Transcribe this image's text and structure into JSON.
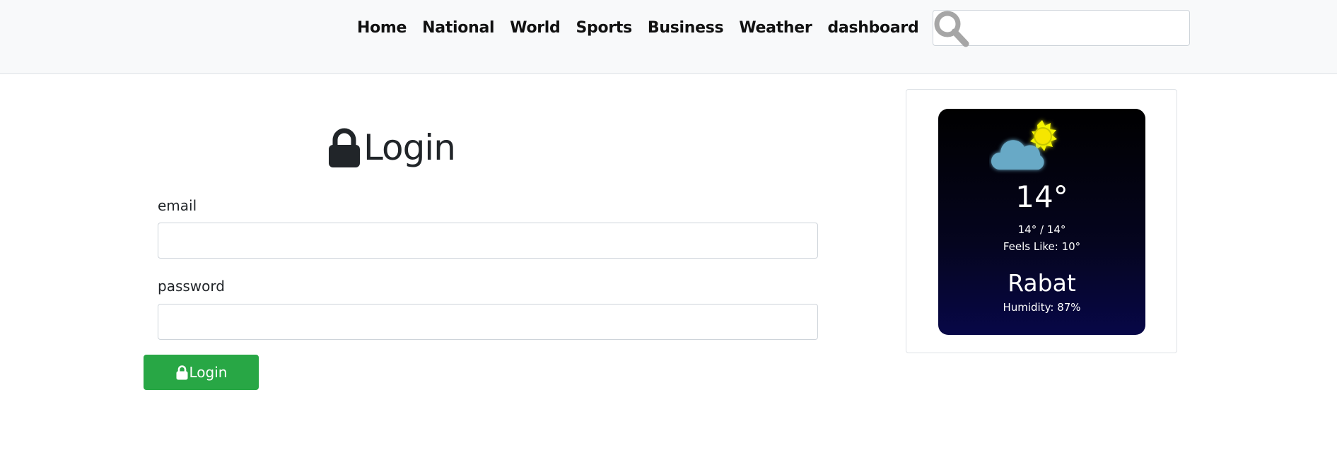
{
  "nav": {
    "items": [
      {
        "label": "Home"
      },
      {
        "label": "National"
      },
      {
        "label": "World"
      },
      {
        "label": "Sports"
      },
      {
        "label": "Business"
      },
      {
        "label": "Weather"
      },
      {
        "label": "dashboard"
      }
    ],
    "search": {
      "value": "",
      "placeholder": "",
      "icon": "search-icon"
    }
  },
  "login": {
    "title": "Login",
    "title_icon": "lock-icon",
    "email_label": "email",
    "email_value": "",
    "password_label": "password",
    "password_value": "",
    "button_label": "Login",
    "button_icon": "lock-icon",
    "button_color": "#28a745"
  },
  "weather": {
    "icon": "partly-cloudy-icon",
    "temperature": "14°",
    "range": "14° / 14°",
    "feels_like": "Feels Like: 10°",
    "city": "Rabat",
    "humidity": "Humidity: 87%"
  }
}
